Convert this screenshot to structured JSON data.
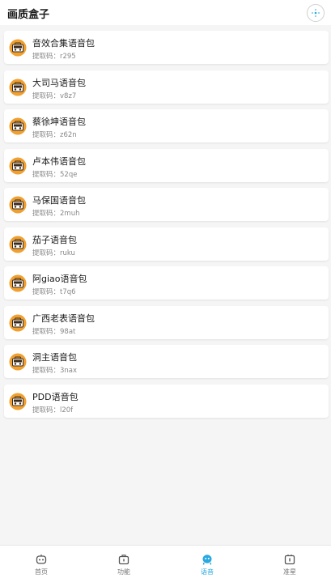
{
  "header": {
    "title": "画质盒子",
    "settings_icon": "compass-icon"
  },
  "packs": [
    {
      "name": "音效合集语音包",
      "code": "提取码：r295"
    },
    {
      "name": "大司马语音包",
      "code": "提取码：v8z7"
    },
    {
      "name": "蔡徐坤语音包",
      "code": "提取码：z62n"
    },
    {
      "name": "卢本伟语音包",
      "code": "提取码：52qe"
    },
    {
      "name": "马保国语音包",
      "code": "提取码：2muh"
    },
    {
      "name": "茄子语音包",
      "code": "提取码：ruku"
    },
    {
      "name": "阿giao语音包",
      "code": "提取码：t7q6"
    },
    {
      "name": "广西老表语音包",
      "code": "提取码：98at"
    },
    {
      "name": "洞主语音包",
      "code": "提取码：3nax"
    },
    {
      "name": "PDD语音包",
      "code": "提取码：l20f"
    }
  ],
  "pack_icon": "boombox-icon",
  "tabbar": {
    "tabs": [
      {
        "label": "首页",
        "icon": "robot-icon"
      },
      {
        "label": "功能",
        "icon": "toolbox-icon"
      },
      {
        "label": "语音",
        "icon": "mascot-icon",
        "active": true
      },
      {
        "label": "准星",
        "icon": "crosshair-icon"
      }
    ]
  },
  "colors": {
    "accent": "#29a9e0",
    "icon_orange": "#f0a030"
  }
}
